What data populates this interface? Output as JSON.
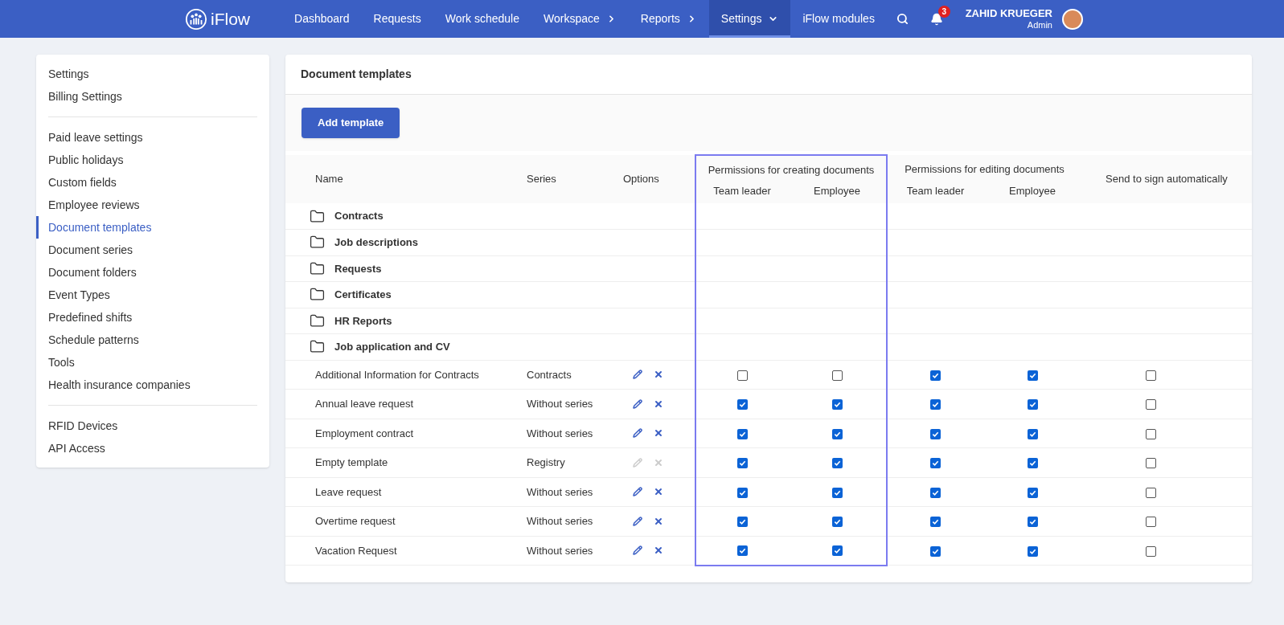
{
  "nav": {
    "logo": "iFlow",
    "items": [
      {
        "label": "Dashboard",
        "selected": false,
        "kind": "link"
      },
      {
        "label": "Requests",
        "selected": false,
        "kind": "link"
      },
      {
        "label": "Work schedule",
        "selected": false,
        "kind": "link"
      },
      {
        "label": "Workspace",
        "selected": false,
        "kind": "submenu"
      },
      {
        "label": "Reports",
        "selected": false,
        "kind": "submenu"
      },
      {
        "label": "Settings",
        "selected": true,
        "kind": "dropdown"
      },
      {
        "label": "iFlow modules",
        "selected": false,
        "kind": "link"
      }
    ],
    "notifications": "3",
    "user": {
      "name": "ZAHID KRUEGER",
      "role": "Admin"
    }
  },
  "sidebar": {
    "groups": [
      [
        {
          "label": "Settings",
          "selected": false
        },
        {
          "label": "Billing Settings",
          "selected": false
        }
      ],
      [
        {
          "label": "Paid leave settings",
          "selected": false
        },
        {
          "label": "Public holidays",
          "selected": false
        },
        {
          "label": "Custom fields",
          "selected": false
        },
        {
          "label": "Employee reviews",
          "selected": false
        },
        {
          "label": "Document templates",
          "selected": true
        },
        {
          "label": "Document series",
          "selected": false
        },
        {
          "label": "Document folders",
          "selected": false
        },
        {
          "label": "Event Types",
          "selected": false
        },
        {
          "label": "Predefined shifts",
          "selected": false
        },
        {
          "label": "Schedule patterns",
          "selected": false
        },
        {
          "label": "Tools",
          "selected": false
        },
        {
          "label": "Health insurance companies",
          "selected": false
        }
      ],
      [
        {
          "label": "RFID Devices",
          "selected": false
        },
        {
          "label": "API Access",
          "selected": false
        }
      ]
    ]
  },
  "main": {
    "title": "Document templates",
    "add_button": "Add template",
    "table": {
      "columns": {
        "name": "Name",
        "series": "Series",
        "options": "Options",
        "send": "Send to sign automatically",
        "groups": [
          {
            "label": "Permissions for creating documents",
            "highlighted": true,
            "sub": [
              "Team leader",
              "Employee"
            ]
          },
          {
            "label": "Permissions for editing documents",
            "highlighted": false,
            "sub": [
              "Team leader",
              "Employee"
            ]
          }
        ]
      },
      "rows": [
        {
          "kind": "folder",
          "name": "Contracts"
        },
        {
          "kind": "folder",
          "name": "Job descriptions"
        },
        {
          "kind": "folder",
          "name": "Requests"
        },
        {
          "kind": "folder",
          "name": "Certificates"
        },
        {
          "kind": "folder",
          "name": "HR Reports"
        },
        {
          "kind": "folder",
          "name": "Job application and CV"
        },
        {
          "kind": "template",
          "name": "Additional Information for Contracts",
          "series": "Contracts",
          "disabled": false,
          "checks": [
            false,
            false,
            true,
            true,
            false
          ]
        },
        {
          "kind": "template",
          "name": "Annual leave request",
          "series": "Without series",
          "disabled": false,
          "checks": [
            true,
            true,
            true,
            true,
            false
          ]
        },
        {
          "kind": "template",
          "name": "Employment contract",
          "series": "Without series",
          "disabled": false,
          "checks": [
            true,
            true,
            true,
            true,
            false
          ]
        },
        {
          "kind": "template",
          "name": "Empty template",
          "series": "Registry",
          "disabled": true,
          "checks": [
            true,
            true,
            true,
            true,
            false
          ]
        },
        {
          "kind": "template",
          "name": "Leave request",
          "series": "Without series",
          "disabled": false,
          "checks": [
            true,
            true,
            true,
            true,
            false
          ]
        },
        {
          "kind": "template",
          "name": "Overtime request",
          "series": "Without series",
          "disabled": false,
          "checks": [
            true,
            true,
            true,
            true,
            false
          ]
        },
        {
          "kind": "template",
          "name": "Vacation Request",
          "series": "Without series",
          "disabled": false,
          "checks": [
            true,
            true,
            true,
            true,
            false
          ]
        }
      ]
    }
  }
}
